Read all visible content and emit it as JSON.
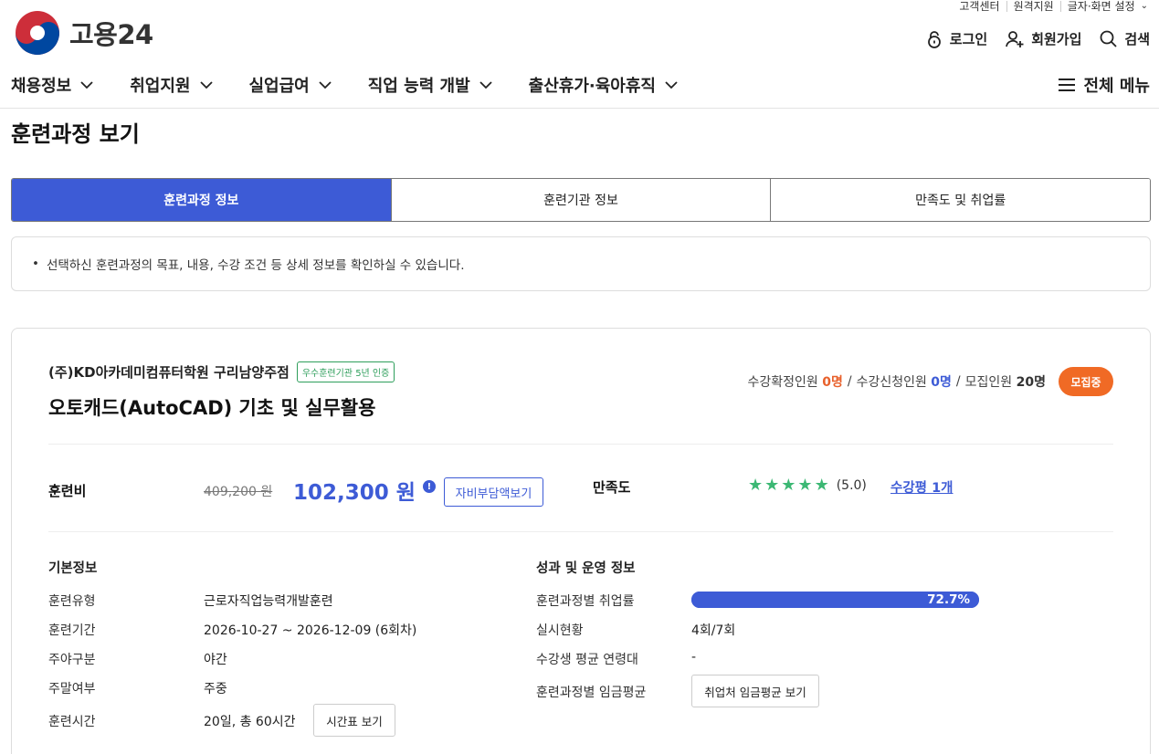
{
  "utility": {
    "customer_center": "고객센터",
    "remote_support": "원격지원",
    "display_settings": "글자·화면 설정"
  },
  "header": {
    "brand": "고용24",
    "login": "로그인",
    "signup": "회원가입",
    "search": "검색"
  },
  "gnb": {
    "items": [
      "채용정보",
      "취업지원",
      "실업급여",
      "직업 능력 개발",
      "출산휴가·육아휴직"
    ],
    "all_menu": "전체 메뉴"
  },
  "page": {
    "title": "훈련과정 보기"
  },
  "tabs": [
    "훈련과정 정보",
    "훈련기관 정보",
    "만족도 및 취업률"
  ],
  "notice": "선택하신 훈련과정의 목표, 내용, 수강 조건 등 상세 정보를 확인하실 수 있습니다.",
  "course": {
    "institution": "(주)KD아카데미컴퓨터학원 구리남양주점",
    "cert_badge": "우수훈련기관 5년 인증",
    "name": "오토캐드(AutoCAD) 기초 및 실무활용",
    "confirmed_label": "수강확정인원",
    "confirmed_value": "0명",
    "applied_label": "수강신청인원",
    "applied_value": "0명",
    "recruit_label": "모집인원",
    "recruit_value": "20명",
    "status": "모집중",
    "fee_label": "훈련비",
    "fee_original": "409,200 원",
    "fee_price": "102,300 원",
    "fee_button": "자비부담액보기",
    "satisfaction_label": "만족도",
    "satisfaction_score": "(5.0)",
    "satisfaction_stars": 5,
    "review_link": "수강평 1개"
  },
  "basic": {
    "title": "기본정보",
    "rows": [
      {
        "label": "훈련유형",
        "value": "근로자직업능력개발훈련"
      },
      {
        "label": "훈련기간",
        "value": "2026-10-27 ~ 2026-12-09 (6회차)"
      },
      {
        "label": "주야구분",
        "value": "야간"
      },
      {
        "label": "주말여부",
        "value": "주중"
      },
      {
        "label": "훈련시간",
        "value": "20일, 총 60시간"
      }
    ],
    "timetable_button": "시간표 보기"
  },
  "performance": {
    "title": "성과 및 운영 정보",
    "employment_label": "훈련과정별 취업률",
    "employment_rate": "72.7%",
    "employment_fraction": 1.0,
    "status_label": "실시현황",
    "status_value": "4회/7회",
    "age_label": "수강생 평균 연령대",
    "age_value": "-",
    "wage_label": "훈련과정별 임금평균",
    "wage_button": "취업처 임금평균 보기"
  },
  "colors": {
    "primary": "#3d5bd6",
    "accent": "#f06a25",
    "star": "#3cb874"
  }
}
